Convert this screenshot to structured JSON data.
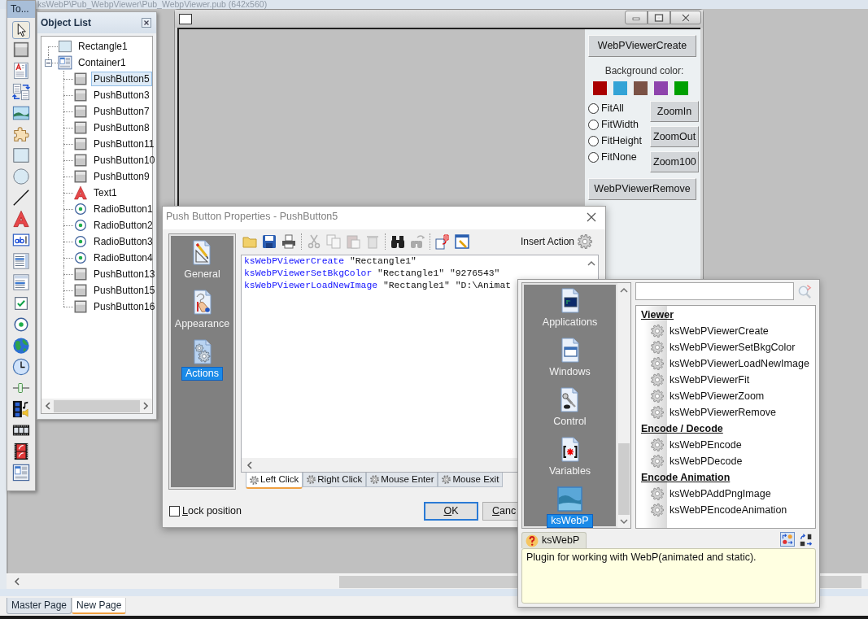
{
  "app": {
    "title": "ksWebP\\Pub_WebpViewer\\Pub_WebpViewer.pub (642x560)"
  },
  "toolbox": {
    "title": "To...",
    "tools": [
      {
        "kind": "pointer",
        "selected": true
      },
      {
        "kind": "push_button",
        "selected": false
      },
      {
        "kind": "text_document",
        "selected": false
      },
      {
        "kind": "document_swap",
        "selected": false
      },
      {
        "kind": "image",
        "selected": false
      },
      {
        "kind": "plugin",
        "selected": false
      },
      {
        "kind": "rectangle",
        "selected": false
      },
      {
        "kind": "ellipse",
        "selected": false
      },
      {
        "kind": "line",
        "selected": false
      },
      {
        "kind": "text",
        "selected": false
      },
      {
        "kind": "edit_box",
        "selected": false
      },
      {
        "kind": "list_box",
        "selected": false
      },
      {
        "kind": "combo_box",
        "selected": false
      },
      {
        "kind": "check_box",
        "selected": false
      },
      {
        "kind": "radio_button",
        "selected": false
      },
      {
        "kind": "web_browser",
        "selected": false
      },
      {
        "kind": "timer",
        "selected": false
      },
      {
        "kind": "slider",
        "selected": false
      },
      {
        "kind": "media_player",
        "selected": false
      },
      {
        "kind": "video",
        "selected": false
      },
      {
        "kind": "flash",
        "selected": false
      },
      {
        "kind": "container",
        "selected": false
      }
    ]
  },
  "object_list": {
    "title": "Object List",
    "items": [
      {
        "label": "Rectangle1",
        "kind": "rectangle",
        "selected": false
      },
      {
        "label": "Container1",
        "kind": "container",
        "selected": false,
        "expanded": true,
        "children": [
          {
            "label": "PushButton5",
            "kind": "push_button",
            "selected": true
          },
          {
            "label": "PushButton3",
            "kind": "push_button",
            "selected": false
          },
          {
            "label": "PushButton7",
            "kind": "push_button",
            "selected": false
          },
          {
            "label": "PushButton8",
            "kind": "push_button",
            "selected": false
          },
          {
            "label": "PushButton11",
            "kind": "push_button",
            "selected": false
          },
          {
            "label": "PushButton10",
            "kind": "push_button",
            "selected": false
          },
          {
            "label": "PushButton9",
            "kind": "push_button",
            "selected": false
          },
          {
            "label": "Text1",
            "kind": "text",
            "selected": false
          },
          {
            "label": "RadioButton1",
            "kind": "radio_button",
            "selected": false
          },
          {
            "label": "RadioButton2",
            "kind": "radio_button",
            "selected": false
          },
          {
            "label": "RadioButton3",
            "kind": "radio_button",
            "selected": false
          },
          {
            "label": "RadioButton4",
            "kind": "radio_button",
            "selected": false
          },
          {
            "label": "PushButton13",
            "kind": "push_button",
            "selected": false
          },
          {
            "label": "PushButton15",
            "kind": "push_button",
            "selected": false
          },
          {
            "label": "PushButton16",
            "kind": "push_button",
            "selected": false
          }
        ]
      }
    ]
  },
  "canvas_window": {
    "panel": {
      "create_button": "WebPViewerCreate",
      "background_label": "Background color:",
      "swatches": [
        {
          "color": "#aa0000"
        },
        {
          "color": "#33a3d6"
        },
        {
          "color": "#7b5246"
        },
        {
          "color": "#8e44ad"
        },
        {
          "color": "#00a000"
        }
      ],
      "fit_options": [
        {
          "label": "FitAll",
          "selected": false
        },
        {
          "label": "FitWidth",
          "selected": false
        },
        {
          "label": "FitHeight",
          "selected": false
        },
        {
          "label": "FitNone",
          "selected": false
        }
      ],
      "zoom_buttons": [
        "ZoomIn",
        "ZoomOut",
        "Zoom100"
      ],
      "remove_button": "WebPViewerRemove"
    }
  },
  "properties_dialog": {
    "title": "Push Button Properties - PushButton5",
    "sections": [
      {
        "label": "General",
        "kind": "general",
        "selected": false
      },
      {
        "label": "Appearance",
        "kind": "appearance",
        "selected": false
      },
      {
        "label": "Actions",
        "kind": "actions",
        "selected": true
      }
    ],
    "toolbar_groups": [
      [
        {
          "kind": "open",
          "disabled": false
        },
        {
          "kind": "save",
          "disabled": false
        },
        {
          "kind": "print",
          "disabled": false
        }
      ],
      [
        {
          "kind": "cut",
          "disabled": true
        },
        {
          "kind": "copy",
          "disabled": true
        },
        {
          "kind": "paste",
          "disabled": true
        },
        {
          "kind": "delete",
          "disabled": true
        }
      ],
      [
        {
          "kind": "find",
          "disabled": false
        },
        {
          "kind": "replace",
          "disabled": true
        }
      ],
      [
        {
          "kind": "insert_variable",
          "disabled": false
        },
        {
          "kind": "edit_window",
          "disabled": false
        }
      ]
    ],
    "insert_action": "Insert Action",
    "script_lines": [
      {
        "command": "ksWebPViewerCreate",
        "arguments": "\"Rectangle1\""
      },
      {
        "command": "ksWebPViewerSetBkgColor",
        "arguments": "\"Rectangle1\" \"9276543\""
      },
      {
        "command": "ksWebPViewerLoadNewImage",
        "arguments": "\"Rectangle1\" \"D:\\Animat"
      }
    ],
    "event_tabs": [
      {
        "label": "Left Click",
        "selected": true
      },
      {
        "label": "Right Click",
        "selected": false
      },
      {
        "label": "Mouse Enter",
        "selected": false
      },
      {
        "label": "Mouse Exit",
        "selected": false
      }
    ],
    "lock_position": {
      "label": "Lock position",
      "checked": false
    },
    "buttons": [
      {
        "label": "OK",
        "default": true
      },
      {
        "label": "Canc",
        "default": false
      }
    ]
  },
  "action_picker": {
    "categories": [
      {
        "label": "Applications",
        "kind": "applications",
        "selected": false
      },
      {
        "label": "Windows",
        "kind": "windows",
        "selected": false
      },
      {
        "label": "Control",
        "kind": "control",
        "selected": false
      },
      {
        "label": "Variables",
        "kind": "variables",
        "selected": false
      },
      {
        "label": "ksWebP",
        "kind": "plugin",
        "selected": true
      }
    ],
    "action_groups": [
      {
        "title": "Viewer",
        "actions": [
          "ksWebPViewerCreate",
          "ksWebPViewerSetBkgColor",
          "ksWebPViewerLoadNewImage",
          "ksWebPViewerFit",
          "ksWebPViewerZoom",
          "ksWebPViewerRemove"
        ]
      },
      {
        "title": "Encode / Decode",
        "actions": [
          "ksWebPEncode",
          "ksWebPDecode"
        ]
      },
      {
        "title": "Encode Animation",
        "actions": [
          "ksWebPAddPngImage",
          "ksWebPEncodeAnimation"
        ]
      }
    ],
    "info_tab": "ksWebP",
    "sort_modes": [
      {
        "kind": "by_category",
        "selected": true
      },
      {
        "kind": "alphabetical",
        "selected": false
      }
    ],
    "description": "Plugin for working with WebP(animated and static)."
  },
  "page_tabs": [
    {
      "label": "Master Page",
      "selected": false
    },
    {
      "label": "New Page",
      "selected": true
    }
  ]
}
